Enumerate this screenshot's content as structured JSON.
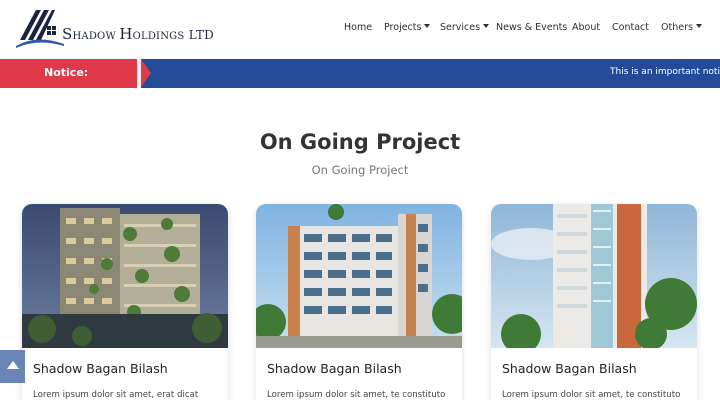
{
  "logo": {
    "text_first_initial": "S",
    "text_first_rest": "HADOW ",
    "text_second_initial": "H",
    "text_second_rest": "OLDINGS",
    "text_suffix": "LTD"
  },
  "nav": {
    "items": [
      {
        "label": "Home",
        "has_dropdown": false
      },
      {
        "label": "Projects",
        "has_dropdown": true
      },
      {
        "label": "Services",
        "has_dropdown": true
      },
      {
        "label": "News & Events",
        "has_dropdown": false
      },
      {
        "label": "About",
        "has_dropdown": false
      },
      {
        "label": "Contact",
        "has_dropdown": false
      },
      {
        "label": "Others",
        "has_dropdown": true
      }
    ]
  },
  "notice": {
    "label": "Notice:",
    "message": "This is an important notice"
  },
  "section": {
    "title": "On Going Project",
    "subtitle": "On Going Project"
  },
  "projects": [
    {
      "title": "Shadow Bagan Bilash",
      "description": "Lorem ipsum dolor sit amet, erat dicat"
    },
    {
      "title": "Shadow Bagan Bilash",
      "description": "Lorem ipsum dolor sit amet, te constituto"
    },
    {
      "title": "Shadow Bagan Bilash",
      "description": "Lorem ipsum dolor sit amet, te constituto"
    }
  ],
  "colors": {
    "notice_label_bg": "#e03a4a",
    "notice_bar_bg": "#234b9a",
    "logo_navy": "#1c2340",
    "scroll_top_bg": "#6a84b8"
  },
  "icons": {
    "scroll_top": "arrow-up-icon",
    "dropdown": "caret-down-icon"
  }
}
